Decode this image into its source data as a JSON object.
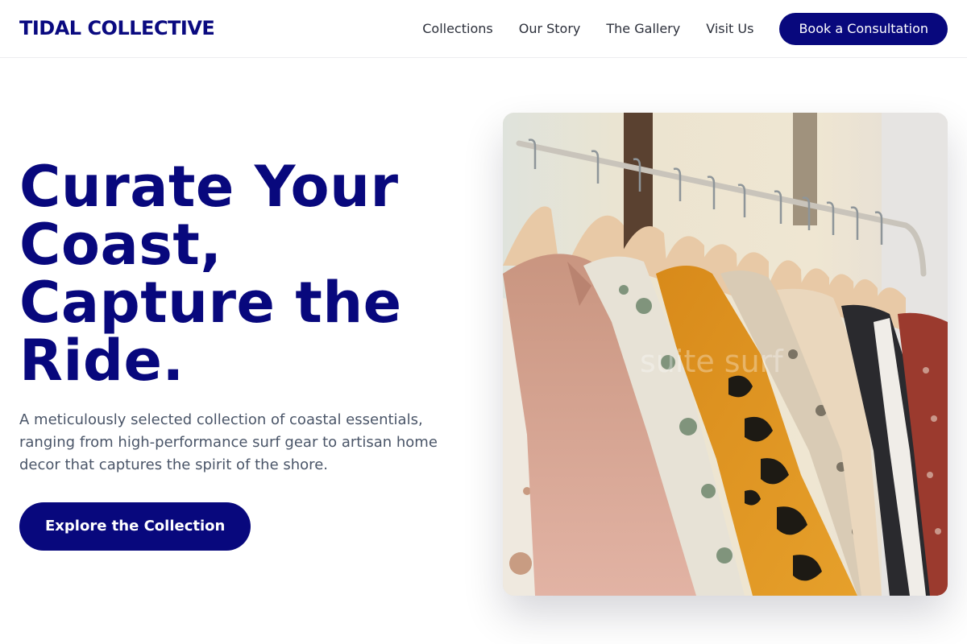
{
  "nav": {
    "brand": "TIDAL COLLECTIVE",
    "links": [
      "Collections",
      "Our Story",
      "The Gallery",
      "Visit Us"
    ],
    "cta": "Book a Consultation"
  },
  "hero": {
    "title": "Curate Your Coast, Capture the Ride.",
    "subtitle": "A meticulously selected collection of coastal essentials, ranging from high-performance surf gear to artisan home decor that captures the spirit of the shore.",
    "button": "Explore the Collection",
    "image_watermark": "suite surf"
  },
  "colors": {
    "brand_navy": "#08087d",
    "body_text": "#4a5568",
    "nav_text": "#2b2f3a"
  }
}
